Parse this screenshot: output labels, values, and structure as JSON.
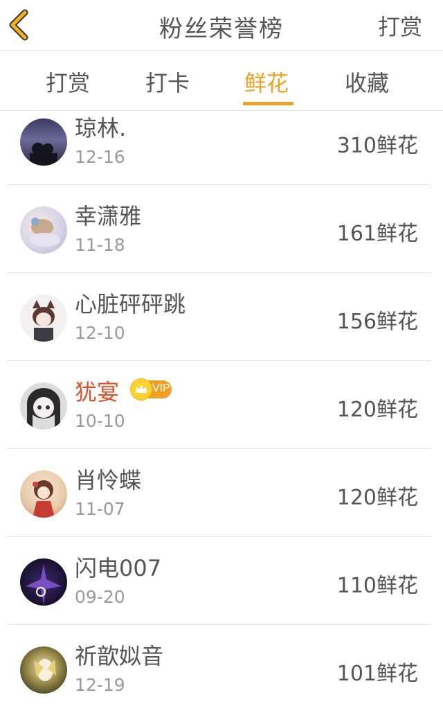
{
  "header": {
    "title": "粉丝荣誉榜",
    "action_label": "打赏",
    "back_icon": "chevron-left-icon",
    "accent_color": "#f0a020"
  },
  "tabs": [
    {
      "label": "打赏",
      "active": false
    },
    {
      "label": "打卡",
      "active": false
    },
    {
      "label": "鲜花",
      "active": true
    },
    {
      "label": "收藏",
      "active": false
    }
  ],
  "fans": [
    {
      "name": "琼林.",
      "date": "12-16",
      "value": "310鲜花",
      "vip": false
    },
    {
      "name": "幸潇雅",
      "date": "11-18",
      "value": "161鲜花",
      "vip": false
    },
    {
      "name": "心脏砰砰跳",
      "date": "12-10",
      "value": "156鲜花",
      "vip": false
    },
    {
      "name": "犹宴",
      "date": "10-10",
      "value": "120鲜花",
      "vip": true,
      "badge_label": "VIP"
    },
    {
      "name": "肖怜蝶",
      "date": "11-07",
      "value": "120鲜花",
      "vip": false
    },
    {
      "name": "闪电007",
      "date": "09-20",
      "value": "110鲜花",
      "vip": false
    },
    {
      "name": "祈歆姒音",
      "date": "12-19",
      "value": "101鲜花",
      "vip": false
    }
  ]
}
